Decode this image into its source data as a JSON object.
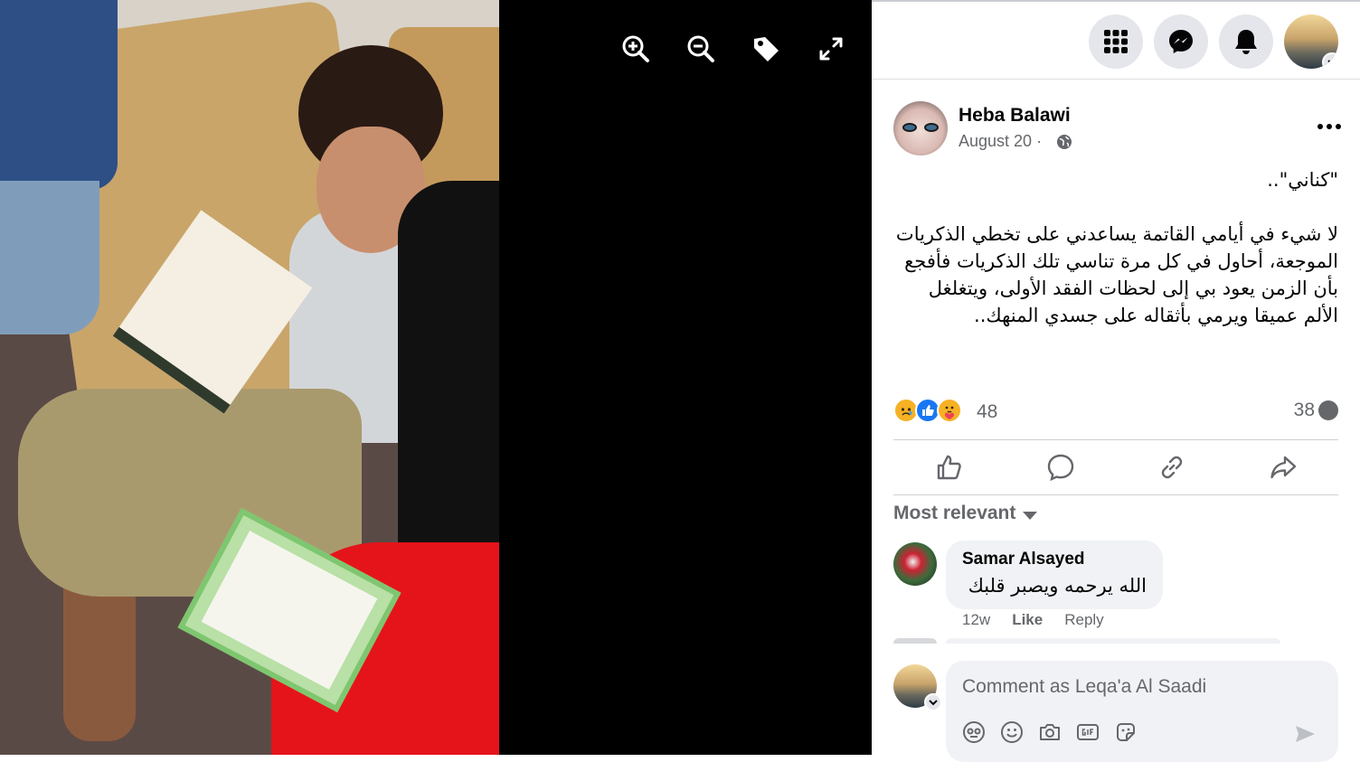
{
  "viewer": {
    "tools": [
      {
        "icon": "zoom-in-icon"
      },
      {
        "icon": "zoom-out-icon"
      },
      {
        "icon": "tag-icon"
      },
      {
        "icon": "fullscreen-icon"
      }
    ]
  },
  "topbar": {
    "buttons": [
      {
        "icon": "menu-grid-icon"
      },
      {
        "icon": "messenger-icon"
      },
      {
        "icon": "notifications-bell-icon"
      }
    ]
  },
  "post": {
    "author": "Heba Balawi",
    "date": "August 20 ·",
    "privacy_icon": "globe-icon",
    "body": "\"كناني\"..\n\nلا شيء في أيامي القاتمة يساعدني على تخطي الذكريات الموجعة، أحاول في كل مرة تناسي تلك الذكريات فأفجع بأن الزمن يعود بي إلى لحظات الفقد الأولى، ويتغلغل الألم عميقا ويرمي بأثقاله على جسدي المنهك..",
    "reactions": {
      "icons": [
        "sad-reaction-icon",
        "like-reaction-icon",
        "care-reaction-icon"
      ],
      "count": "48"
    },
    "comments_count": "38"
  },
  "actions": [
    {
      "icon": "like-icon"
    },
    {
      "icon": "comment-icon"
    },
    {
      "icon": "link-icon"
    },
    {
      "icon": "share-icon"
    }
  ],
  "comments_sort": "Most relevant",
  "comments": [
    {
      "name": "Samar Alsayed",
      "text": "الله يرحمه ويصبر قلبك",
      "time": "12w",
      "like": "Like",
      "reply": "Reply"
    }
  ],
  "composer": {
    "placeholder": "Comment as Leqa'a Al Saadi",
    "tools": [
      "avatar-sticker-icon",
      "emoji-icon",
      "camera-icon",
      "gif-icon",
      "sticker-icon"
    ],
    "send_icon": "send-icon"
  },
  "colors": {
    "secondary_text": "#65676b",
    "button_bg": "#e4e6eb",
    "bubble_bg": "#f0f2f5",
    "like_blue": "#1877f2",
    "viewer_bg": "#000000"
  }
}
